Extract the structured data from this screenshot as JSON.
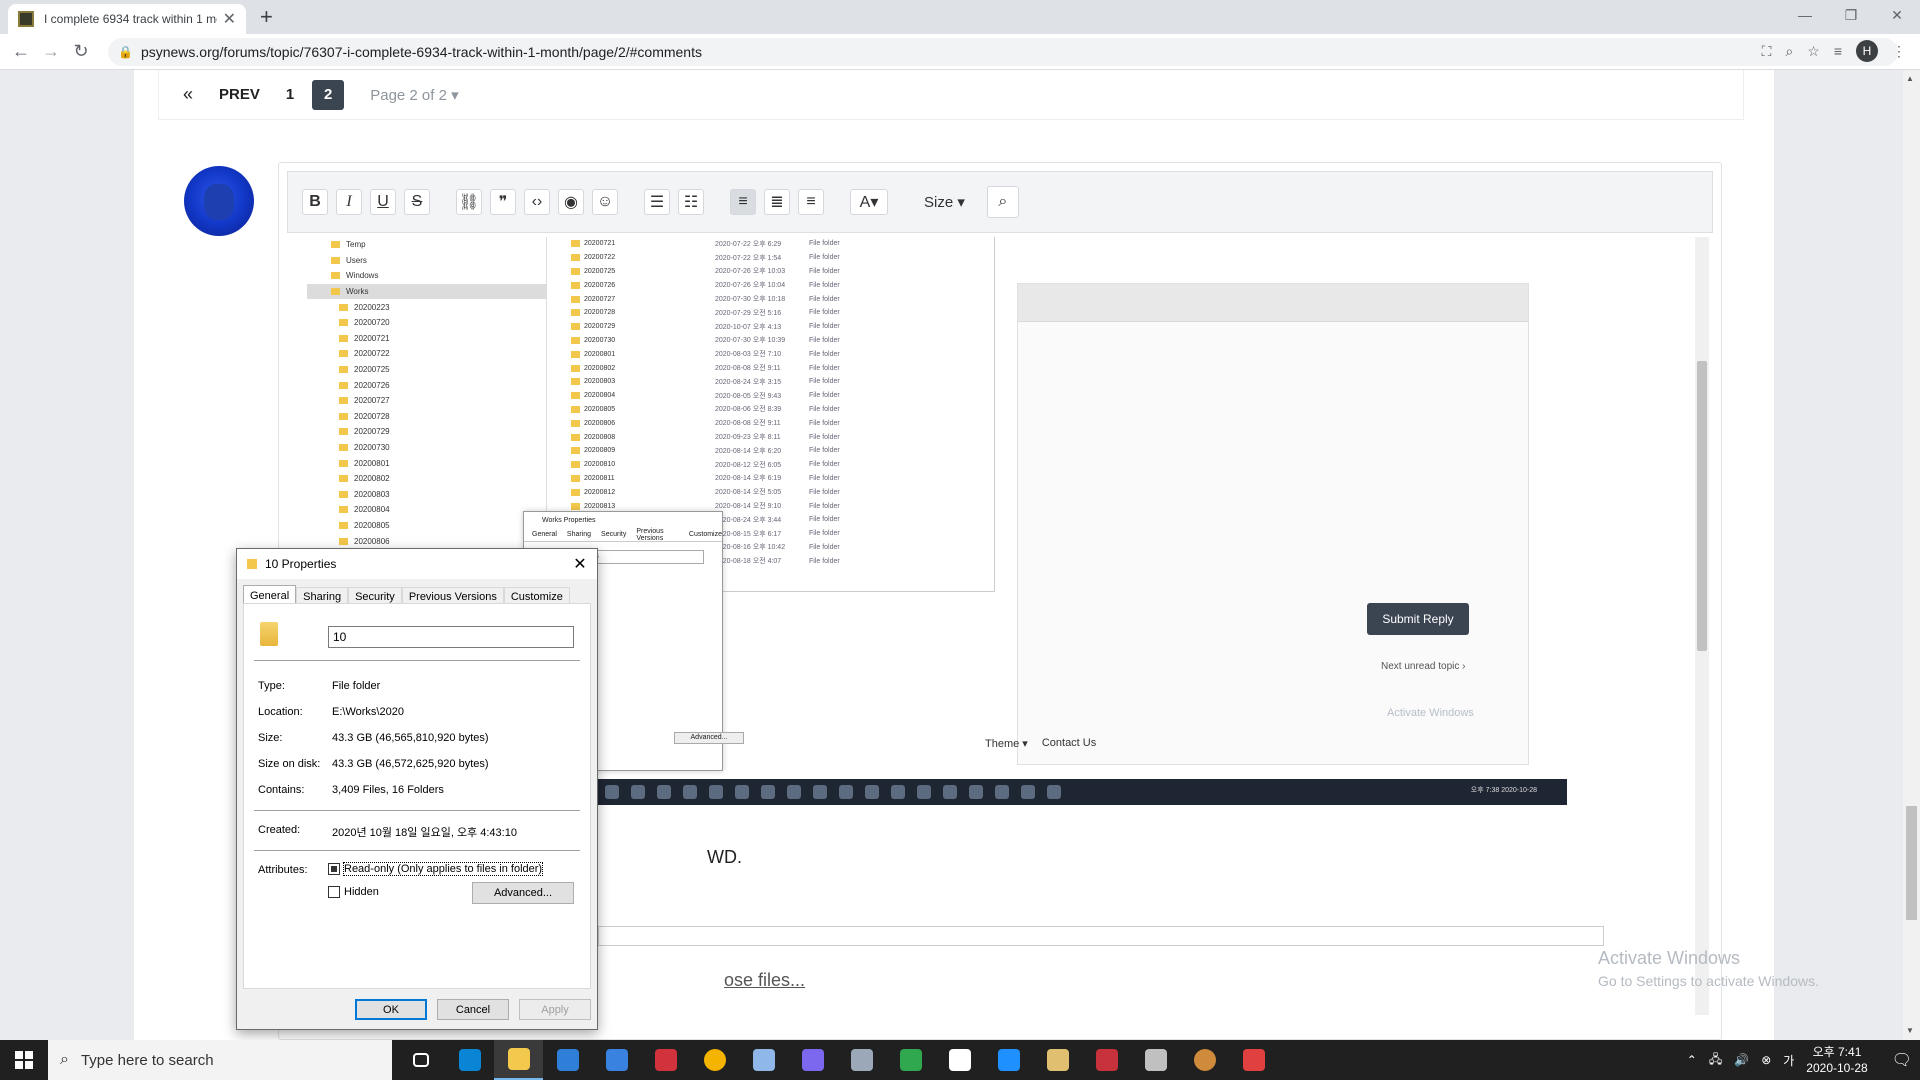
{
  "browser": {
    "tab_title": "I complete 6934 track within 1 mon",
    "url": "psynews.org/forums/topic/76307-i-complete-6934-track-within-1-month/page/2/#comments",
    "profile_initial": "H"
  },
  "pagination": {
    "prev_label": "PREV",
    "pages": [
      "1",
      "2"
    ],
    "current": "2",
    "page_of": "Page 2 of 2"
  },
  "editor": {
    "size_label": "Size",
    "body_text": "WD.",
    "attach_text": "ose files..."
  },
  "embedded_shot": {
    "tree_items": [
      "Temp",
      "Users",
      "Windows",
      "Works",
      "20200223",
      "20200720",
      "20200721",
      "20200722",
      "20200725",
      "20200726",
      "20200727",
      "20200728",
      "20200729",
      "20200730",
      "20200801",
      "20200802",
      "20200803",
      "20200804",
      "20200805",
      "20200806"
    ],
    "list_rows": [
      [
        "20200721",
        "2020-07-22 오후 6:29",
        "File folder"
      ],
      [
        "20200722",
        "2020-07-22 오후 1:54",
        "File folder"
      ],
      [
        "20200725",
        "2020-07-26 오후 10:03",
        "File folder"
      ],
      [
        "20200726",
        "2020-07-26 오후 10:04",
        "File folder"
      ],
      [
        "20200727",
        "2020-07-30 오후 10:18",
        "File folder"
      ],
      [
        "20200728",
        "2020-07-29 오전 5:16",
        "File folder"
      ],
      [
        "20200729",
        "2020-10-07 오후 4:13",
        "File folder"
      ],
      [
        "20200730",
        "2020-07-30 오후 10:39",
        "File folder"
      ],
      [
        "20200801",
        "2020-08-03 오전 7:10",
        "File folder"
      ],
      [
        "20200802",
        "2020-08-08 오전 9:11",
        "File folder"
      ],
      [
        "20200803",
        "2020-08-24 오후 3:15",
        "File folder"
      ],
      [
        "20200804",
        "2020-08-05 오전 9:43",
        "File folder"
      ],
      [
        "20200805",
        "2020-08-06 오전 8:39",
        "File folder"
      ],
      [
        "20200806",
        "2020-08-08 오전 9:11",
        "File folder"
      ],
      [
        "20200808",
        "2020-09-23 오후 8:11",
        "File folder"
      ],
      [
        "20200809",
        "2020-08-14 오후 6:20",
        "File folder"
      ],
      [
        "20200810",
        "2020-08-12 오전 6:05",
        "File folder"
      ],
      [
        "20200811",
        "2020-08-14 오후 6:19",
        "File folder"
      ],
      [
        "20200812",
        "2020-08-14 오전 5:05",
        "File folder"
      ],
      [
        "20200813",
        "2020-08-14 오전 9:10",
        "File folder"
      ],
      [
        "20200814",
        "2020-08-24 오후 3:44",
        "File folder"
      ],
      [
        "20200815",
        "2020-08-15 오후 6:17",
        "File folder"
      ],
      [
        "20200816",
        "2020-08-16 오후 10:42",
        "File folder"
      ],
      [
        "20200817",
        "2020-08-18 오전 4:07",
        "File folder"
      ]
    ],
    "submit_reply": "Submit Reply",
    "next_unread": "Next unread topic",
    "theme": "Theme",
    "contact": "Contact Us",
    "ghost_activate": "Activate Windows",
    "inner_clock": "오후 7:38 2020-10-28",
    "works_dialog": {
      "title": "Works Properties",
      "tabs": [
        "General",
        "Sharing",
        "Security",
        "Previous Versions",
        "Customize"
      ],
      "name": "Works",
      "advanced": "Advanced..."
    }
  },
  "dialog": {
    "title": "10 Properties",
    "tabs": [
      "General",
      "Sharing",
      "Security",
      "Previous Versions",
      "Customize"
    ],
    "name_value": "10",
    "type_label": "Type:",
    "type_value": "File folder",
    "location_label": "Location:",
    "location_value": "E:\\Works\\2020",
    "size_label": "Size:",
    "size_value": "43.3 GB (46,565,810,920 bytes)",
    "sod_label": "Size on disk:",
    "sod_value": "43.3 GB (46,572,625,920 bytes)",
    "contains_label": "Contains:",
    "contains_value": "3,409 Files, 16 Folders",
    "created_label": "Created:",
    "created_value": "2020년 10월 18일 일요일, 오후 4:43:10",
    "attributes_label": "Attributes:",
    "readonly_label": "Read-only (Only applies to files in folder)",
    "hidden_label": "Hidden",
    "advanced_label": "Advanced...",
    "ok": "OK",
    "cancel": "Cancel",
    "apply": "Apply"
  },
  "watermark": {
    "line1": "Activate Windows",
    "line2": "Go to Settings to activate Windows."
  },
  "taskbar": {
    "search_placeholder": "Type here to search",
    "time": "오후 7:41",
    "date": "2020-10-28",
    "app_colors": [
      "#4aa3df",
      "#0a84d4",
      "#f2c94c",
      "#2f7fd8",
      "#3a82e0",
      "#d2323c",
      "#f4b400",
      "#8fb8e8",
      "#7b68ee",
      "#9aa8b8",
      "#2fa84f",
      "#ffffff",
      "#1e90ff",
      "#e0c070",
      "#c8323c",
      "#c0c0c0",
      "#d08a3c",
      "#e04040"
    ]
  }
}
